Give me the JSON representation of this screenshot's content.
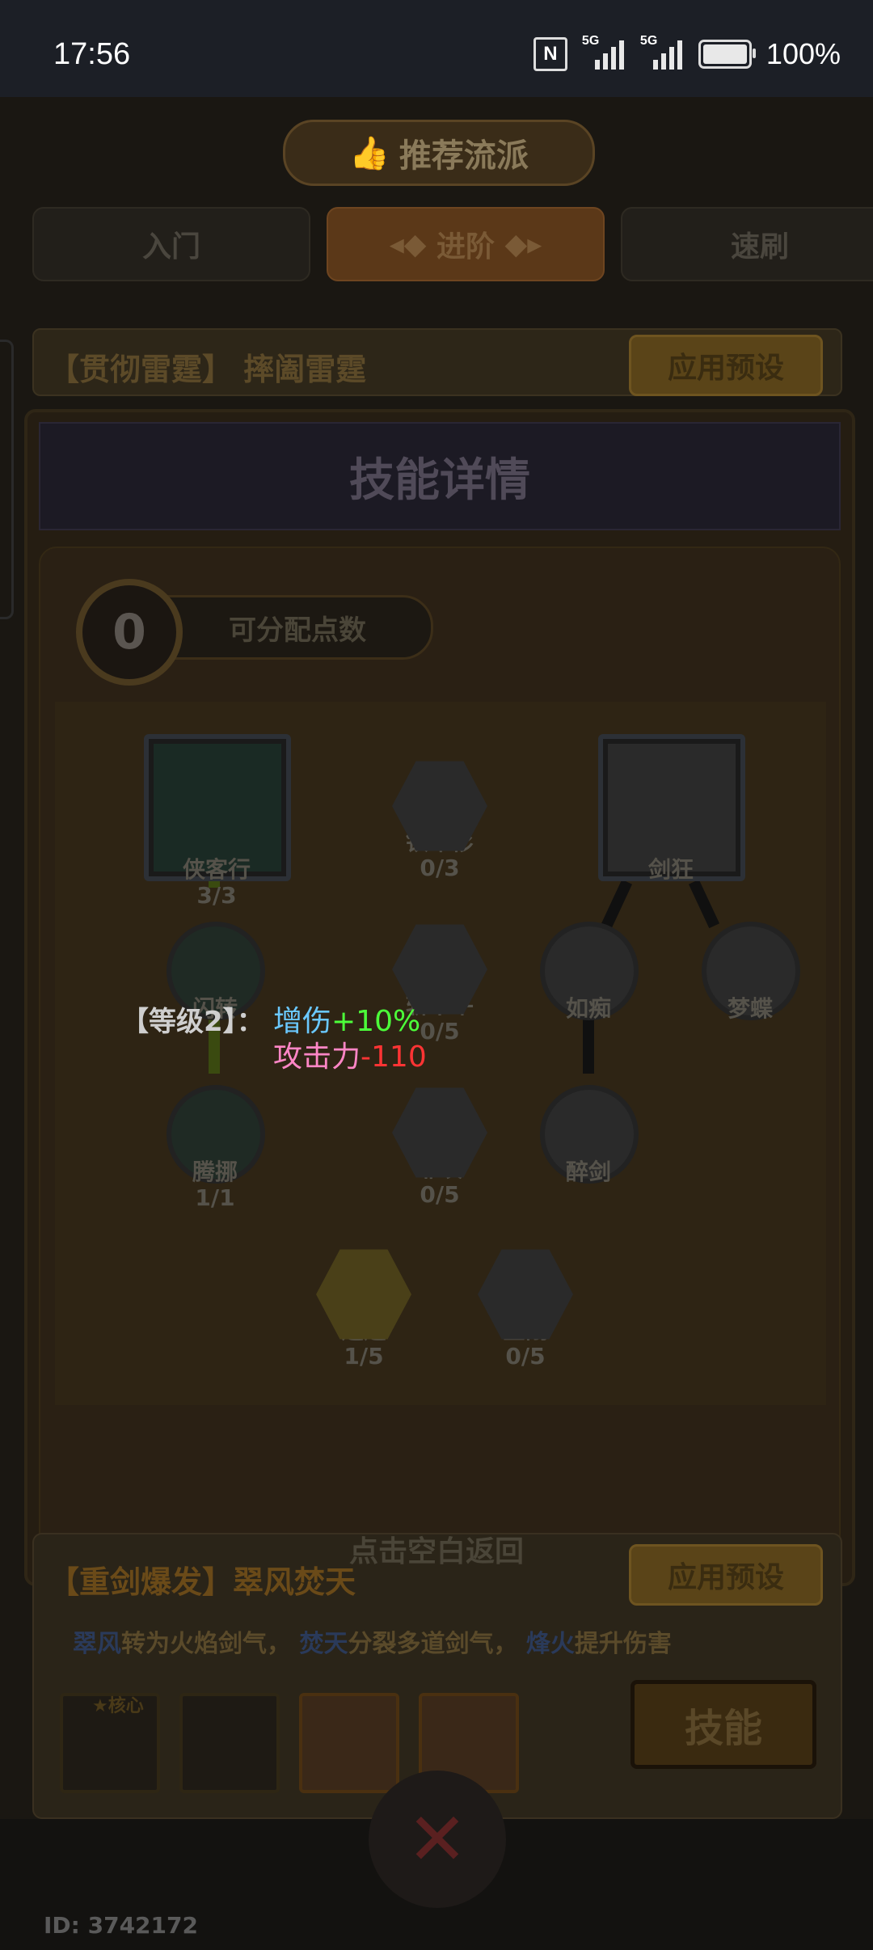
{
  "status_bar": {
    "time": "17:56",
    "nfc": "N",
    "signal1": "5G",
    "signal2": "5G",
    "battery": "100%"
  },
  "banner": {
    "title": "推荐流派"
  },
  "tabs": [
    {
      "label": "入门",
      "active": false
    },
    {
      "label": "进阶",
      "active": true
    },
    {
      "label": "速刷",
      "active": false
    }
  ],
  "preset_top": {
    "title": "【贯彻雷霆】 摔阖雷霆",
    "apply_label": "应用预设"
  },
  "skill_panel": {
    "header": "技能详情",
    "points_value": "0",
    "points_label": "可分配点数"
  },
  "skill_nodes": [
    {
      "id": "xiakexing",
      "label": "侠客行",
      "count": "3/3"
    },
    {
      "id": "tiebushan",
      "label": "铁布衫",
      "count": "0/3"
    },
    {
      "id": "jiankuang",
      "label": "剑狂",
      "count": ""
    },
    {
      "id": "shanzhuan",
      "label": "闪转",
      "count": ""
    },
    {
      "id": "zhanbuping",
      "label": "斩不平",
      "count": "0/5"
    },
    {
      "id": "ruchi",
      "label": "如痴",
      "count": ""
    },
    {
      "id": "mengdie",
      "label": "梦蝶",
      "count": ""
    },
    {
      "id": "tengnuo",
      "label": "腾挪",
      "count": "1/1"
    },
    {
      "id": "feigong",
      "label": "非攻",
      "count": "0/5"
    },
    {
      "id": "zuijian",
      "label": "醉剑",
      "count": ""
    },
    {
      "id": "xiaoyao",
      "label": "逍遥",
      "count": "1/5"
    },
    {
      "id": "jingang",
      "label": "金刚",
      "count": "0/5"
    }
  ],
  "tooltip": {
    "level": "【等级2】：",
    "line1_name": "增伤",
    "line1_value": "+10%",
    "line2_name": "攻击力",
    "line2_value": "-110"
  },
  "back_hint": "点击空白返回",
  "preset_bottom": {
    "title": "【重剑爆发】翠风焚天",
    "apply_label": "应用预设",
    "desc_k1": "翠风",
    "desc_t1": "转为火焰剑气，",
    "desc_k2": "焚天",
    "desc_t2": "分裂多道剑气，",
    "desc_k3": "烽火",
    "desc_t3": "提升伤害",
    "core_label": "★核心",
    "skill_button": "技能"
  },
  "footer": {
    "id_label": "ID: 3742172"
  },
  "colors": {
    "tooltip_blue": "#6ac8ff",
    "tooltip_green": "#4cff3a",
    "tooltip_pink": "#ff86c6",
    "tooltip_red": "#ff3434"
  }
}
